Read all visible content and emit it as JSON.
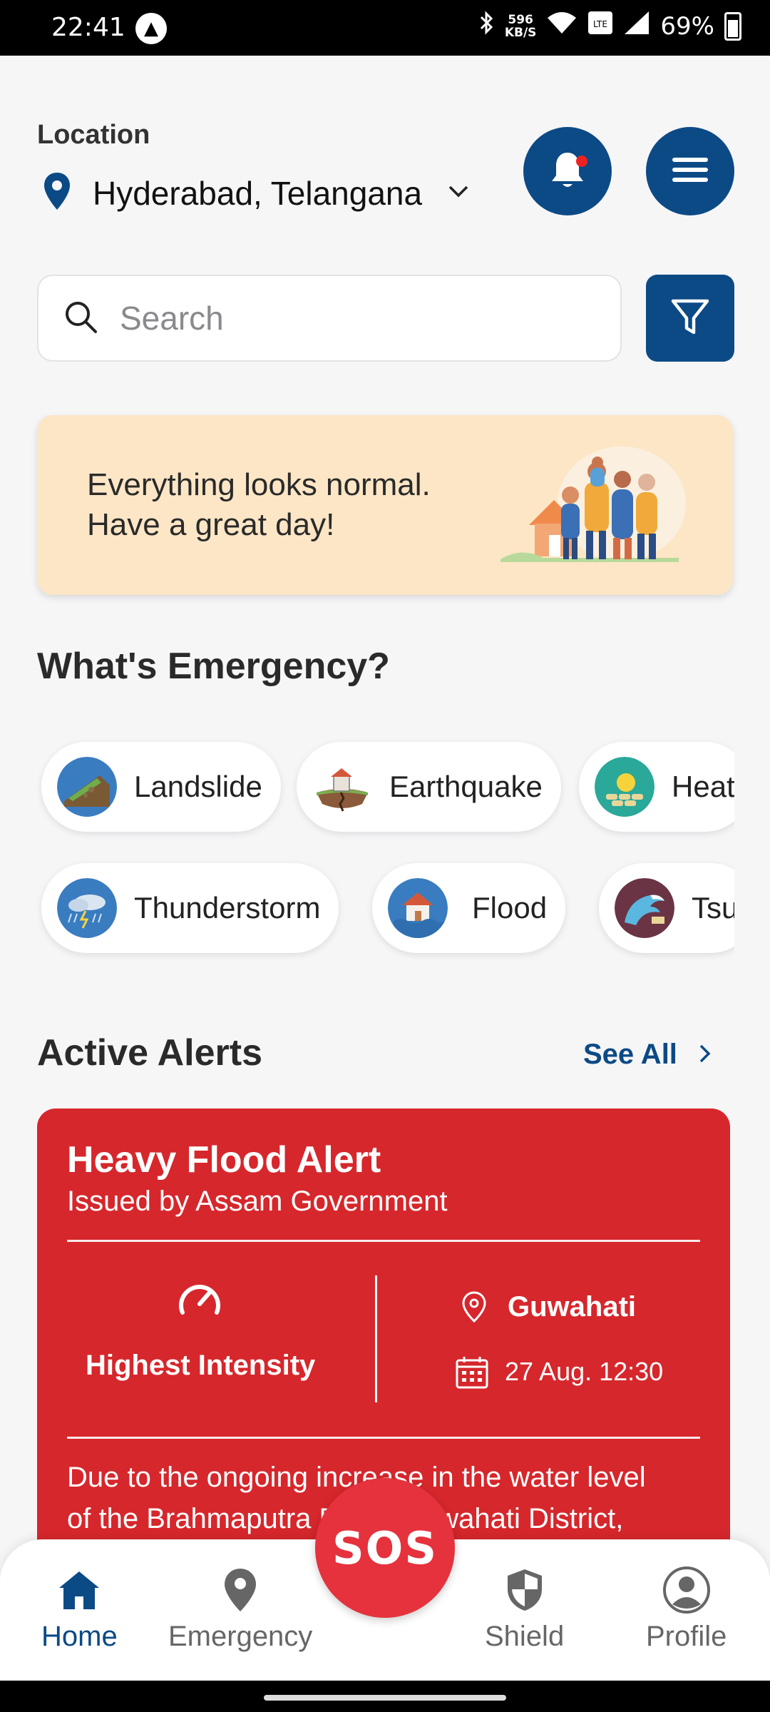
{
  "status_bar": {
    "time": "22:41",
    "speed_top": "596",
    "speed_bottom": "KB/S",
    "battery": "69%"
  },
  "location": {
    "label": "Location",
    "value": "Hyderabad, Telangana"
  },
  "search": {
    "placeholder": "Search"
  },
  "banner": {
    "line1": "Everything looks normal.",
    "line2": "Have a great day!"
  },
  "emergency": {
    "title": "What's Emergency?",
    "items": [
      {
        "label": "Landslide",
        "icon": "landslide-icon"
      },
      {
        "label": "Earthquake",
        "icon": "earthquake-icon"
      },
      {
        "label": "Heat",
        "icon": "heatwave-icon"
      },
      {
        "label": "Thunderstorm",
        "icon": "thunderstorm-icon"
      },
      {
        "label": "Flood",
        "icon": "flood-icon"
      },
      {
        "label": "Tsu",
        "icon": "tsunami-icon"
      }
    ]
  },
  "alerts": {
    "title": "Active Alerts",
    "see_all": "See All",
    "card": {
      "title": "Heavy Flood Alert",
      "issuer": "Issued by Assam Government",
      "intensity": "Highest Intensity",
      "place": "Guwahati",
      "datetime": "27 Aug. 12:30",
      "line1": "Due to the ongoing increase in the water level",
      "line2": "of the Brahmaputra River, Guwahati District,"
    }
  },
  "nav": {
    "home": "Home",
    "emergency": "Emergency",
    "sos": "SOS",
    "shield": "Shield",
    "profile": "Profile"
  },
  "colors": {
    "primary": "#0c4a86",
    "alert_red": "#d6272c",
    "sos_red": "#e5323d",
    "banner_bg": "#fde6c6"
  }
}
